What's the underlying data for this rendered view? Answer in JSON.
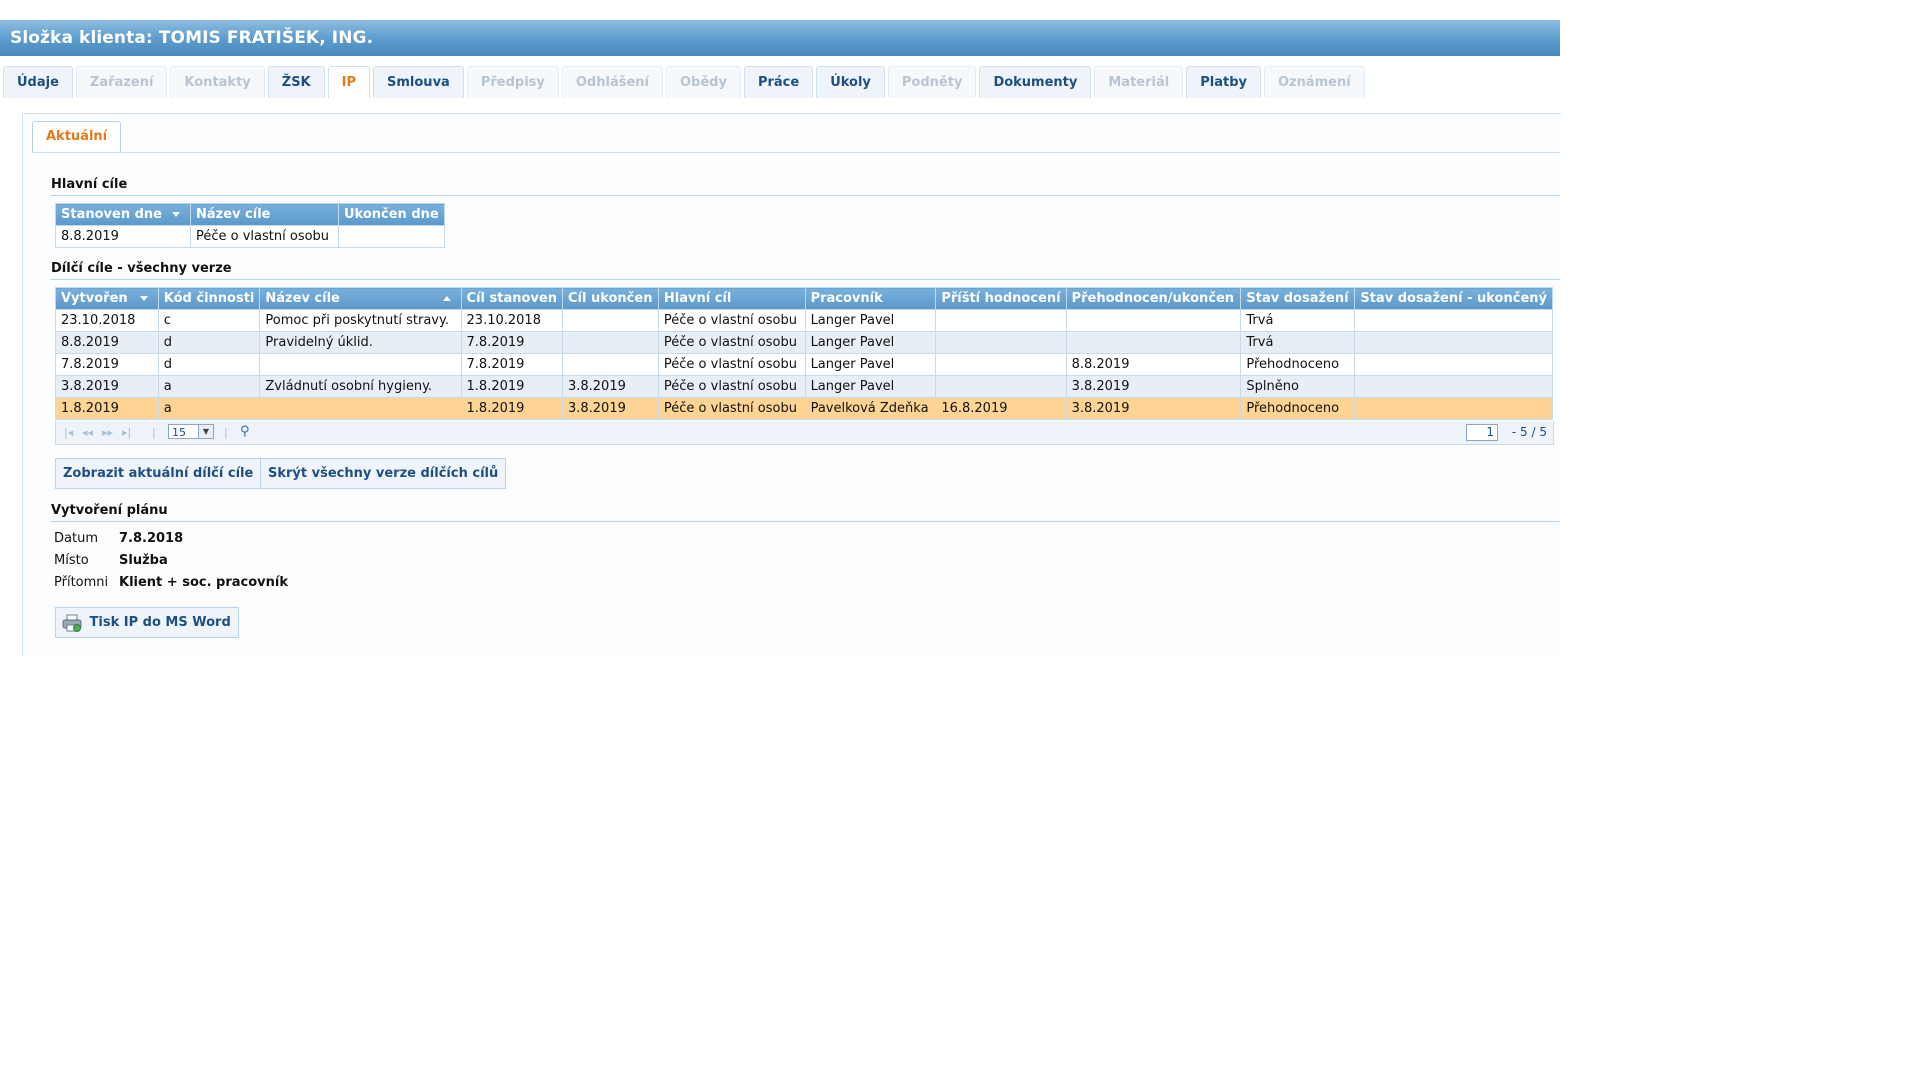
{
  "header": {
    "title": "Složka klienta: TOMIS FRATIŠEK, ING."
  },
  "tabs": [
    {
      "label": "Údaje",
      "state": "enabled"
    },
    {
      "label": "Zařazení",
      "state": "disabled"
    },
    {
      "label": "Kontakty",
      "state": "disabled"
    },
    {
      "label": "ŽSK",
      "state": "enabled"
    },
    {
      "label": "IP",
      "state": "active"
    },
    {
      "label": "Smlouva",
      "state": "enabled"
    },
    {
      "label": "Předpisy",
      "state": "disabled"
    },
    {
      "label": "Odhlášení",
      "state": "disabled"
    },
    {
      "label": "Obědy",
      "state": "disabled"
    },
    {
      "label": "Práce",
      "state": "enabled"
    },
    {
      "label": "Úkoly",
      "state": "enabled"
    },
    {
      "label": "Podněty",
      "state": "disabled"
    },
    {
      "label": "Dokumenty",
      "state": "enabled"
    },
    {
      "label": "Materiál",
      "state": "disabled"
    },
    {
      "label": "Platby",
      "state": "enabled"
    },
    {
      "label": "Oznámení",
      "state": "disabled"
    }
  ],
  "subtab": {
    "label": "Aktuální"
  },
  "main_goals": {
    "title": "Hlavní cíle",
    "headers": [
      "Stanoven dne",
      "Název cíle",
      "Ukončen dne"
    ],
    "rows": [
      [
        "8.8.2019",
        "Péče o vlastní osobu",
        ""
      ]
    ]
  },
  "partial_goals": {
    "title": "Dílčí cíle - všechny verze",
    "headers": [
      "Vytvořen",
      "Kód činnosti",
      "Název cíle",
      "Cíl stanoven",
      "Cíl ukončen",
      "Hlavní cíl",
      "Pracovník",
      "Příští hodnocení",
      "Přehodnocen/ukončen",
      "Stav dosažení",
      "Stav dosažení - ukončený"
    ],
    "rows": [
      [
        "23.10.2018",
        "c",
        "Pomoc při poskytnutí stravy.",
        "23.10.2018",
        "",
        "Péče o vlastní osobu",
        "Langer Pavel",
        "",
        "",
        "Trvá",
        ""
      ],
      [
        "8.8.2019",
        "d",
        "Pravidelný úklid.",
        "7.8.2019",
        "",
        "Péče o vlastní osobu",
        "Langer Pavel",
        "",
        "",
        "Trvá",
        ""
      ],
      [
        "7.8.2019",
        "d",
        "",
        "7.8.2019",
        "",
        "Péče o vlastní osobu",
        "Langer Pavel",
        "",
        "8.8.2019",
        "Přehodnoceno",
        ""
      ],
      [
        "3.8.2019",
        "a",
        "Zvládnutí osobní hygieny.",
        "1.8.2019",
        "3.8.2019",
        "Péče o vlastní osobu",
        "Langer Pavel",
        "",
        "3.8.2019",
        "Splněno",
        ""
      ],
      [
        "1.8.2019",
        "a",
        "",
        "1.8.2019",
        "3.8.2019",
        "Péče o vlastní osobu",
        "Pavelková Zdeňka",
        "16.8.2019",
        "3.8.2019",
        "Přehodnoceno",
        ""
      ]
    ],
    "selected_row": 4,
    "pager": {
      "page_size": "15",
      "current_page": "1",
      "range": "- 5 / 5"
    }
  },
  "buttons": {
    "show_current": "Zobrazit aktuální dílčí cíle",
    "hide_versions": "Skrýt všechny verze dílčích cílů",
    "print": "Tisk IP do MS Word"
  },
  "plan": {
    "title": "Vytvoření plánu",
    "fields": [
      {
        "label": "Datum",
        "value": "7.8.2018"
      },
      {
        "label": "Místo",
        "value": "Služba"
      },
      {
        "label": "Přítomni",
        "value": "Klient + soc. pracovník"
      }
    ]
  },
  "colors": {
    "accent": "#e07a18",
    "header": "#5b98ca",
    "selected_row": "#fdd493"
  }
}
